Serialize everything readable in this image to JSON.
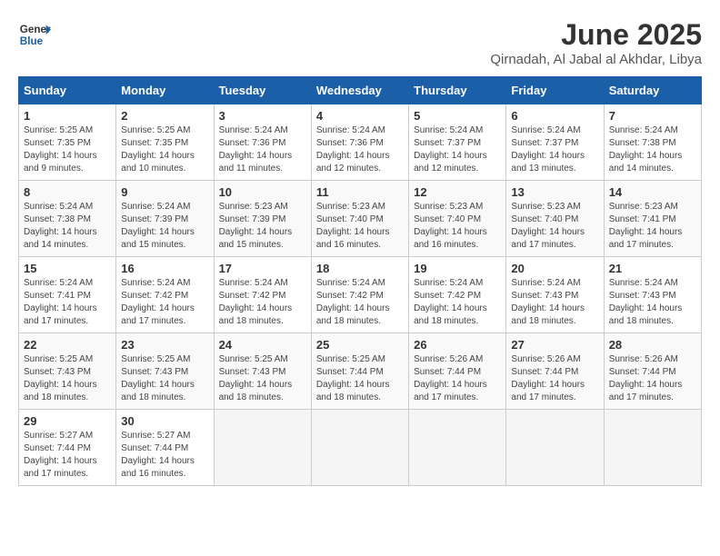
{
  "logo": {
    "line1": "General",
    "line2": "Blue"
  },
  "title": "June 2025",
  "subtitle": "Qirnadah, Al Jabal al Akhdar, Libya",
  "weekdays": [
    "Sunday",
    "Monday",
    "Tuesday",
    "Wednesday",
    "Thursday",
    "Friday",
    "Saturday"
  ],
  "weeks": [
    [
      {
        "day": "1",
        "info": "Sunrise: 5:25 AM\nSunset: 7:35 PM\nDaylight: 14 hours and 9 minutes."
      },
      {
        "day": "2",
        "info": "Sunrise: 5:25 AM\nSunset: 7:35 PM\nDaylight: 14 hours and 10 minutes."
      },
      {
        "day": "3",
        "info": "Sunrise: 5:24 AM\nSunset: 7:36 PM\nDaylight: 14 hours and 11 minutes."
      },
      {
        "day": "4",
        "info": "Sunrise: 5:24 AM\nSunset: 7:36 PM\nDaylight: 14 hours and 12 minutes."
      },
      {
        "day": "5",
        "info": "Sunrise: 5:24 AM\nSunset: 7:37 PM\nDaylight: 14 hours and 12 minutes."
      },
      {
        "day": "6",
        "info": "Sunrise: 5:24 AM\nSunset: 7:37 PM\nDaylight: 14 hours and 13 minutes."
      },
      {
        "day": "7",
        "info": "Sunrise: 5:24 AM\nSunset: 7:38 PM\nDaylight: 14 hours and 14 minutes."
      }
    ],
    [
      {
        "day": "8",
        "info": "Sunrise: 5:24 AM\nSunset: 7:38 PM\nDaylight: 14 hours and 14 minutes."
      },
      {
        "day": "9",
        "info": "Sunrise: 5:24 AM\nSunset: 7:39 PM\nDaylight: 14 hours and 15 minutes."
      },
      {
        "day": "10",
        "info": "Sunrise: 5:23 AM\nSunset: 7:39 PM\nDaylight: 14 hours and 15 minutes."
      },
      {
        "day": "11",
        "info": "Sunrise: 5:23 AM\nSunset: 7:40 PM\nDaylight: 14 hours and 16 minutes."
      },
      {
        "day": "12",
        "info": "Sunrise: 5:23 AM\nSunset: 7:40 PM\nDaylight: 14 hours and 16 minutes."
      },
      {
        "day": "13",
        "info": "Sunrise: 5:23 AM\nSunset: 7:40 PM\nDaylight: 14 hours and 17 minutes."
      },
      {
        "day": "14",
        "info": "Sunrise: 5:23 AM\nSunset: 7:41 PM\nDaylight: 14 hours and 17 minutes."
      }
    ],
    [
      {
        "day": "15",
        "info": "Sunrise: 5:24 AM\nSunset: 7:41 PM\nDaylight: 14 hours and 17 minutes."
      },
      {
        "day": "16",
        "info": "Sunrise: 5:24 AM\nSunset: 7:42 PM\nDaylight: 14 hours and 17 minutes."
      },
      {
        "day": "17",
        "info": "Sunrise: 5:24 AM\nSunset: 7:42 PM\nDaylight: 14 hours and 18 minutes."
      },
      {
        "day": "18",
        "info": "Sunrise: 5:24 AM\nSunset: 7:42 PM\nDaylight: 14 hours and 18 minutes."
      },
      {
        "day": "19",
        "info": "Sunrise: 5:24 AM\nSunset: 7:42 PM\nDaylight: 14 hours and 18 minutes."
      },
      {
        "day": "20",
        "info": "Sunrise: 5:24 AM\nSunset: 7:43 PM\nDaylight: 14 hours and 18 minutes."
      },
      {
        "day": "21",
        "info": "Sunrise: 5:24 AM\nSunset: 7:43 PM\nDaylight: 14 hours and 18 minutes."
      }
    ],
    [
      {
        "day": "22",
        "info": "Sunrise: 5:25 AM\nSunset: 7:43 PM\nDaylight: 14 hours and 18 minutes."
      },
      {
        "day": "23",
        "info": "Sunrise: 5:25 AM\nSunset: 7:43 PM\nDaylight: 14 hours and 18 minutes."
      },
      {
        "day": "24",
        "info": "Sunrise: 5:25 AM\nSunset: 7:43 PM\nDaylight: 14 hours and 18 minutes."
      },
      {
        "day": "25",
        "info": "Sunrise: 5:25 AM\nSunset: 7:44 PM\nDaylight: 14 hours and 18 minutes."
      },
      {
        "day": "26",
        "info": "Sunrise: 5:26 AM\nSunset: 7:44 PM\nDaylight: 14 hours and 17 minutes."
      },
      {
        "day": "27",
        "info": "Sunrise: 5:26 AM\nSunset: 7:44 PM\nDaylight: 14 hours and 17 minutes."
      },
      {
        "day": "28",
        "info": "Sunrise: 5:26 AM\nSunset: 7:44 PM\nDaylight: 14 hours and 17 minutes."
      }
    ],
    [
      {
        "day": "29",
        "info": "Sunrise: 5:27 AM\nSunset: 7:44 PM\nDaylight: 14 hours and 17 minutes."
      },
      {
        "day": "30",
        "info": "Sunrise: 5:27 AM\nSunset: 7:44 PM\nDaylight: 14 hours and 16 minutes."
      },
      null,
      null,
      null,
      null,
      null
    ]
  ]
}
